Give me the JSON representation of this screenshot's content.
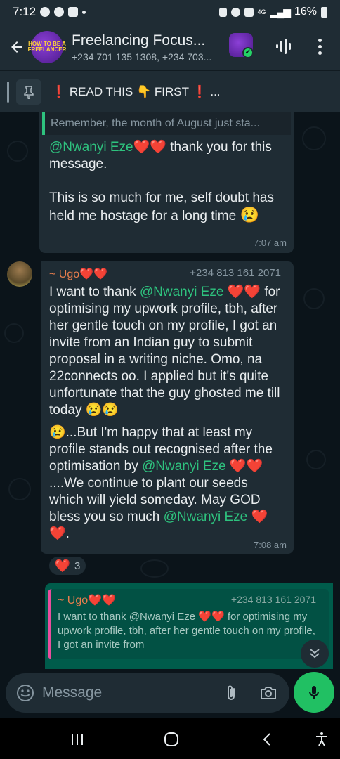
{
  "status_bar": {
    "time": "7:12",
    "network": "4G",
    "battery": "16%"
  },
  "header": {
    "title": "Freelancing Focus...",
    "subtitle": "+234 701 135 1308, +234 703...",
    "avatar_text": "HOW TO BE A FREELANCER"
  },
  "pinned": {
    "text": "READ THIS 👇 FIRST",
    "suffix": "..."
  },
  "messages": [
    {
      "quote": "Remember, the month of August just sta...",
      "mention": "@Nwanyi Eze",
      "hearts": "❤️❤️",
      "text_after_mention": " thank you for this message.",
      "para2": "This is so much for me, self doubt has held me hostage for a long time",
      "emoji": "😢",
      "time": "7:07 am"
    },
    {
      "sender": "~ Ugo❤️❤️",
      "phone": "+234 813 161 2071",
      "part1": "I want to thank ",
      "mention1": "@Nwanyi Eze",
      "part2": " ❤️❤️ for optimising my upwork profile, tbh, after her gentle touch on my profile, I got an invite from an Indian guy to submit proposal in a writing niche. Omo, na 22connects oo. I applied but it's quite unfortunate that the guy ghosted me till today 😢😢",
      "part3": "😢...But I'm happy that at least my profile stands out recognised after the optimisation by ",
      "mention2": "@Nwanyi Eze",
      "part4": " ❤️❤️ ....We continue to plant our seeds which will yield someday. May GOD bless you so much ",
      "mention3": "@Nwanyi Eze",
      "part5": " ❤️❤️.",
      "time": "7:08 am",
      "reaction_emoji": "❤️",
      "reaction_count": "3"
    },
    {
      "quote_sender": "~ Ugo❤️❤️",
      "quote_phone": "+234 813 161 2071",
      "quote_text": "I want to thank @Nwanyi Eze ❤️❤️ for optimising my upwork profile, tbh, after her gentle touch on my profile, I got an invite from"
    }
  ],
  "input": {
    "placeholder": "Message"
  }
}
